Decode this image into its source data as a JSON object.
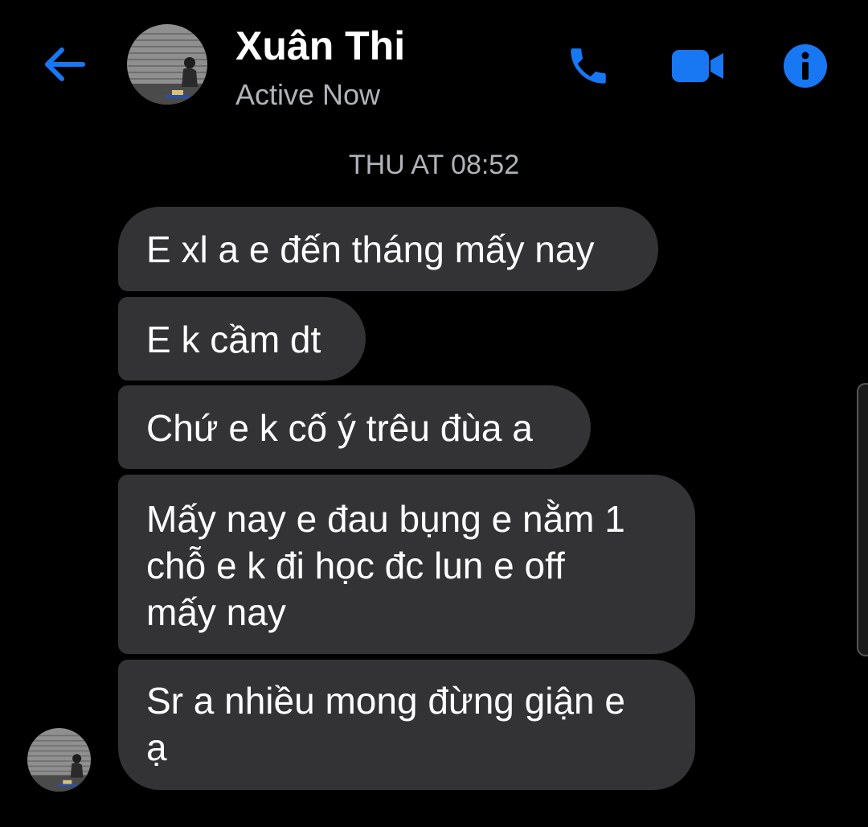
{
  "header": {
    "back_icon": "arrow-left-icon",
    "contact_name": "Xuân Thi",
    "status": "Active Now",
    "call_icon": "phone-icon",
    "video_icon": "video-camera-icon",
    "info_icon": "info-icon"
  },
  "conversation": {
    "timestamp": "THU AT 08:52",
    "messages": [
      {
        "text": "E xl a e đến tháng mấy nay"
      },
      {
        "text": "E k cầm dt"
      },
      {
        "text": "Chứ e k cố ý trêu đùa a"
      },
      {
        "text": "Mấy nay e đau bụng e nằm 1\nchỗ e k đi học đc lun e off\nmấy nay"
      },
      {
        "text": "Sr a nhiều mong đừng giận e\nạ"
      }
    ]
  },
  "colors": {
    "background": "#000000",
    "accent": "#1877f2",
    "bubble": "#333335",
    "secondary_text": "#b0b3b8"
  }
}
